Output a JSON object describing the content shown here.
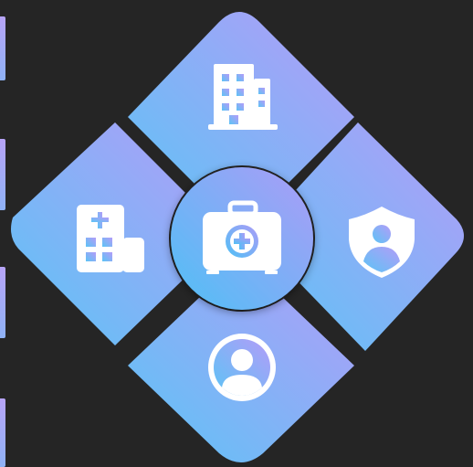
{
  "tiles": [
    {
      "id": "top",
      "icon": "office-building-icon"
    },
    {
      "id": "left",
      "icon": "hospital-building-icon"
    },
    {
      "id": "right",
      "icon": "shield-user-icon"
    },
    {
      "id": "bottom",
      "icon": "user-profile-icon"
    }
  ],
  "center": {
    "icon": "medical-kit-icon"
  },
  "colors": {
    "background": "#252525",
    "gradient_start": "#5cc4f5",
    "gradient_end": "#b39cf8",
    "icon": "#ffffff"
  }
}
